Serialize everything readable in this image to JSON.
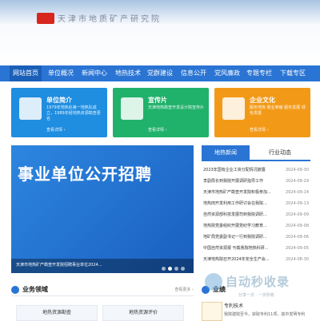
{
  "header": {
    "logo_text": "天津市地质矿产研究院"
  },
  "nav": {
    "items": [
      "网站首页",
      "单位概况",
      "新闻中心",
      "地热技术",
      "党群建设",
      "信息公开",
      "党风廉政",
      "专题专栏",
      "下载专区"
    ]
  },
  "cards": [
    {
      "title": "单位简介",
      "desc": "1979年地热处第一地热队成立，1989年经地热资源勘查更名",
      "more": "查看详情 ›",
      "color": "#1f8de0"
    },
    {
      "title": "宣传片",
      "desc": "天津地热勘查开发设计院宣传片",
      "more": "查看详情 ›",
      "color": "#20b26b"
    },
    {
      "title": "企业文化",
      "desc": "服务地热 敬业奉献 服务发展 绿色发展",
      "more": "查看详情 ›",
      "color": "#f29a18"
    }
  ],
  "banner": {
    "text": "事业单位公开招聘",
    "caption": "天津市地热矿产勘查开发院招聘事业单位2024..."
  },
  "news": {
    "tabs": [
      "地热新闻",
      "行业动态"
    ],
    "items": [
      {
        "title": "2023年国有企业工资分配情况披露",
        "date": "2024-09-30"
      },
      {
        "title": "李副局长到我院开展调研指导工作",
        "date": "2024-09-29"
      },
      {
        "title": "天津市地热矿产勘查开发院积极参加...",
        "date": "2024-09-14"
      },
      {
        "title": "地热田开发利用工作研讨会在我院...",
        "date": "2024-09-13"
      },
      {
        "title": "自然资源部科技发展司到我院调研...",
        "date": "2024-09-09"
      },
      {
        "title": "地热院党委组织开展党纪学习教育...",
        "date": "2024-09-08"
      },
      {
        "title": "地矿局党委副书记一行到我院调研...",
        "date": "2024-09-06"
      },
      {
        "title": "中国自然资源报 刊载我院地热科研...",
        "date": "2024-09-05"
      },
      {
        "title": "天津地热院召开2024年安全生产会...",
        "date": "2024-08-30"
      }
    ]
  },
  "business": {
    "title": "业务领域",
    "more": "查看更多 ›",
    "items": [
      "地热资源勘查",
      "地热资源评价"
    ]
  },
  "side": {
    "title": "业绩",
    "patent_title": "专利技术",
    "patent_desc": "我院建院至今，获取专利11项，其中发明专利"
  },
  "watermark": {
    "text": "自动秒收录",
    "sub": "分享一次 · 一次秒收"
  }
}
